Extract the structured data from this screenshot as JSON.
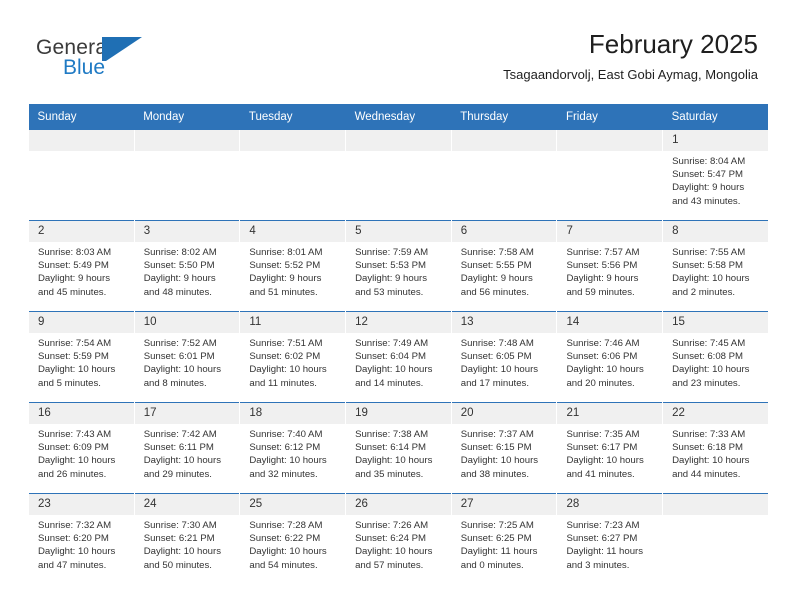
{
  "brand": {
    "name_top": "General",
    "name_bottom": "Blue",
    "logo_icon": "triangle-flag-icon",
    "accent_color": "#1f7ac4"
  },
  "header": {
    "month_title": "February 2025",
    "location": "Tsagaandorvolj, East Gobi Aymag, Mongolia"
  },
  "theme": {
    "header_blue": "#2e73b8",
    "daynum_band": "#f0f0f0",
    "text": "#333333"
  },
  "calendar": {
    "weekday_headers": [
      "Sunday",
      "Monday",
      "Tuesday",
      "Wednesday",
      "Thursday",
      "Friday",
      "Saturday"
    ],
    "labels": {
      "sunrise": "Sunrise:",
      "sunset": "Sunset:",
      "daylight": "Daylight:"
    },
    "weeks": [
      [
        {
          "day": "",
          "empty": true
        },
        {
          "day": "",
          "empty": true
        },
        {
          "day": "",
          "empty": true
        },
        {
          "day": "",
          "empty": true
        },
        {
          "day": "",
          "empty": true
        },
        {
          "day": "",
          "empty": true
        },
        {
          "day": "1",
          "sunrise": "Sunrise: 8:04 AM",
          "sunset": "Sunset: 5:47 PM",
          "daylight_line1": "Daylight: 9 hours",
          "daylight_line2": "and 43 minutes."
        }
      ],
      [
        {
          "day": "2",
          "sunrise": "Sunrise: 8:03 AM",
          "sunset": "Sunset: 5:49 PM",
          "daylight_line1": "Daylight: 9 hours",
          "daylight_line2": "and 45 minutes."
        },
        {
          "day": "3",
          "sunrise": "Sunrise: 8:02 AM",
          "sunset": "Sunset: 5:50 PM",
          "daylight_line1": "Daylight: 9 hours",
          "daylight_line2": "and 48 minutes."
        },
        {
          "day": "4",
          "sunrise": "Sunrise: 8:01 AM",
          "sunset": "Sunset: 5:52 PM",
          "daylight_line1": "Daylight: 9 hours",
          "daylight_line2": "and 51 minutes."
        },
        {
          "day": "5",
          "sunrise": "Sunrise: 7:59 AM",
          "sunset": "Sunset: 5:53 PM",
          "daylight_line1": "Daylight: 9 hours",
          "daylight_line2": "and 53 minutes."
        },
        {
          "day": "6",
          "sunrise": "Sunrise: 7:58 AM",
          "sunset": "Sunset: 5:55 PM",
          "daylight_line1": "Daylight: 9 hours",
          "daylight_line2": "and 56 minutes."
        },
        {
          "day": "7",
          "sunrise": "Sunrise: 7:57 AM",
          "sunset": "Sunset: 5:56 PM",
          "daylight_line1": "Daylight: 9 hours",
          "daylight_line2": "and 59 minutes."
        },
        {
          "day": "8",
          "sunrise": "Sunrise: 7:55 AM",
          "sunset": "Sunset: 5:58 PM",
          "daylight_line1": "Daylight: 10 hours",
          "daylight_line2": "and 2 minutes."
        }
      ],
      [
        {
          "day": "9",
          "sunrise": "Sunrise: 7:54 AM",
          "sunset": "Sunset: 5:59 PM",
          "daylight_line1": "Daylight: 10 hours",
          "daylight_line2": "and 5 minutes."
        },
        {
          "day": "10",
          "sunrise": "Sunrise: 7:52 AM",
          "sunset": "Sunset: 6:01 PM",
          "daylight_line1": "Daylight: 10 hours",
          "daylight_line2": "and 8 minutes."
        },
        {
          "day": "11",
          "sunrise": "Sunrise: 7:51 AM",
          "sunset": "Sunset: 6:02 PM",
          "daylight_line1": "Daylight: 10 hours",
          "daylight_line2": "and 11 minutes."
        },
        {
          "day": "12",
          "sunrise": "Sunrise: 7:49 AM",
          "sunset": "Sunset: 6:04 PM",
          "daylight_line1": "Daylight: 10 hours",
          "daylight_line2": "and 14 minutes."
        },
        {
          "day": "13",
          "sunrise": "Sunrise: 7:48 AM",
          "sunset": "Sunset: 6:05 PM",
          "daylight_line1": "Daylight: 10 hours",
          "daylight_line2": "and 17 minutes."
        },
        {
          "day": "14",
          "sunrise": "Sunrise: 7:46 AM",
          "sunset": "Sunset: 6:06 PM",
          "daylight_line1": "Daylight: 10 hours",
          "daylight_line2": "and 20 minutes."
        },
        {
          "day": "15",
          "sunrise": "Sunrise: 7:45 AM",
          "sunset": "Sunset: 6:08 PM",
          "daylight_line1": "Daylight: 10 hours",
          "daylight_line2": "and 23 minutes."
        }
      ],
      [
        {
          "day": "16",
          "sunrise": "Sunrise: 7:43 AM",
          "sunset": "Sunset: 6:09 PM",
          "daylight_line1": "Daylight: 10 hours",
          "daylight_line2": "and 26 minutes."
        },
        {
          "day": "17",
          "sunrise": "Sunrise: 7:42 AM",
          "sunset": "Sunset: 6:11 PM",
          "daylight_line1": "Daylight: 10 hours",
          "daylight_line2": "and 29 minutes."
        },
        {
          "day": "18",
          "sunrise": "Sunrise: 7:40 AM",
          "sunset": "Sunset: 6:12 PM",
          "daylight_line1": "Daylight: 10 hours",
          "daylight_line2": "and 32 minutes."
        },
        {
          "day": "19",
          "sunrise": "Sunrise: 7:38 AM",
          "sunset": "Sunset: 6:14 PM",
          "daylight_line1": "Daylight: 10 hours",
          "daylight_line2": "and 35 minutes."
        },
        {
          "day": "20",
          "sunrise": "Sunrise: 7:37 AM",
          "sunset": "Sunset: 6:15 PM",
          "daylight_line1": "Daylight: 10 hours",
          "daylight_line2": "and 38 minutes."
        },
        {
          "day": "21",
          "sunrise": "Sunrise: 7:35 AM",
          "sunset": "Sunset: 6:17 PM",
          "daylight_line1": "Daylight: 10 hours",
          "daylight_line2": "and 41 minutes."
        },
        {
          "day": "22",
          "sunrise": "Sunrise: 7:33 AM",
          "sunset": "Sunset: 6:18 PM",
          "daylight_line1": "Daylight: 10 hours",
          "daylight_line2": "and 44 minutes."
        }
      ],
      [
        {
          "day": "23",
          "sunrise": "Sunrise: 7:32 AM",
          "sunset": "Sunset: 6:20 PM",
          "daylight_line1": "Daylight: 10 hours",
          "daylight_line2": "and 47 minutes."
        },
        {
          "day": "24",
          "sunrise": "Sunrise: 7:30 AM",
          "sunset": "Sunset: 6:21 PM",
          "daylight_line1": "Daylight: 10 hours",
          "daylight_line2": "and 50 minutes."
        },
        {
          "day": "25",
          "sunrise": "Sunrise: 7:28 AM",
          "sunset": "Sunset: 6:22 PM",
          "daylight_line1": "Daylight: 10 hours",
          "daylight_line2": "and 54 minutes."
        },
        {
          "day": "26",
          "sunrise": "Sunrise: 7:26 AM",
          "sunset": "Sunset: 6:24 PM",
          "daylight_line1": "Daylight: 10 hours",
          "daylight_line2": "and 57 minutes."
        },
        {
          "day": "27",
          "sunrise": "Sunrise: 7:25 AM",
          "sunset": "Sunset: 6:25 PM",
          "daylight_line1": "Daylight: 11 hours",
          "daylight_line2": "and 0 minutes."
        },
        {
          "day": "28",
          "sunrise": "Sunrise: 7:23 AM",
          "sunset": "Sunset: 6:27 PM",
          "daylight_line1": "Daylight: 11 hours",
          "daylight_line2": "and 3 minutes."
        },
        {
          "day": "",
          "empty": true
        }
      ]
    ]
  }
}
